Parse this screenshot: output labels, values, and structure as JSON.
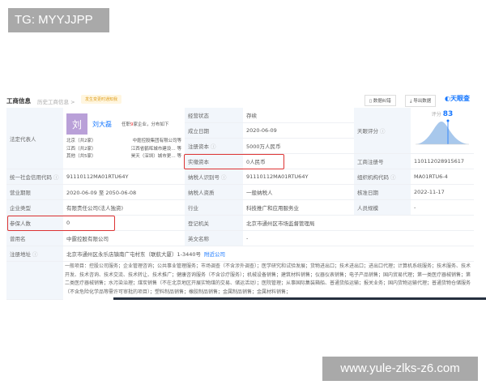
{
  "watermarks": {
    "top": "TG: MYYJJPP",
    "bottom": "www.yule-zlks-z6.com"
  },
  "header": {
    "title": "工商信息",
    "history": "历史工商信息 >",
    "tip": "发生变更时通知我",
    "btn_report": "数据纠错",
    "btn_export": "导出数据",
    "logo": "天眼查"
  },
  "legal": {
    "label": "法定代表人",
    "avatar": "刘",
    "name": "刘大磊",
    "summary_pre": "任职",
    "summary_count": "9",
    "summary_post": "家企业，分布如下",
    "regions": [
      {
        "r": "北京（共2家）",
        "c": "中霆控股集团有限公司等"
      },
      {
        "r": "江西（共2家）",
        "c": "江西省鹤晖城市建设…  等"
      },
      {
        "r": "其他（共5家）",
        "c": "昊天（深圳）城市更…  等"
      }
    ]
  },
  "rows_left": [
    {
      "label": "统一社会信用代码",
      "value": "91110112MA01RTU64Y"
    },
    {
      "label": "营业期限",
      "value": "2020-06-09 至 2050-06-08"
    },
    {
      "label": "企业类型",
      "value": "有限责任公司(法人独资)"
    },
    {
      "label": "参保人数",
      "value": "0"
    },
    {
      "label": "曾用名",
      "value": "中霆控股有限公司"
    },
    {
      "label": "注册地址",
      "value": "北京市通州区永乐店镇南广屯村东（联航大厦）1-3440号",
      "link": "附近公司"
    }
  ],
  "rows_mid": [
    {
      "label": "经营状态",
      "value": "存续"
    },
    {
      "label": "成立日期",
      "value": "2020-06-09"
    },
    {
      "label": "注册资本",
      "value": "5000万人民币"
    },
    {
      "label": "实缴资本",
      "value": "0人民币"
    },
    {
      "label": "纳税人识别号",
      "value": "91110112MA01RTU64Y"
    },
    {
      "label": "纳税人资质",
      "value": "一般纳税人"
    },
    {
      "label": "行业",
      "value": "科技推广和应用服务业"
    },
    {
      "label": "登记机关",
      "value": "北京市通州区市场监督管理局"
    },
    {
      "label": "英文名称",
      "value": "-"
    }
  ],
  "rows_right": [
    {
      "label": "天眼评分",
      "score_label": "评分",
      "score": "83"
    },
    {
      "label": "工商注册号",
      "value": "110112028915617"
    },
    {
      "label": "组织机构代码",
      "value": "MA01RTU6-4"
    },
    {
      "label": "核准日期",
      "value": "2022-11-17"
    },
    {
      "label": "人员规模",
      "value": "-"
    }
  ],
  "scope": "一般项目：控股公司服务；企业管理咨询；公共事业管理服务；市场调查（不含涉外调查）；医学研究和试验发展；货物进出口；技术进出口；进出口代理；计算机系统服务；技术服务、技术开发、技术咨询、技术交流、技术转让、技术推广；健康咨询服务（不含诊疗服务）；机械设备销售；建筑材料销售；仪器仪表销售；电子产品销售；国内贸易代理；第一类医疗器械销售；第二类医疗器械销售；水污染治理；煤炭销售（不在北京地区开展实物煤的交易、储运活动）；医院管理；从事国际集装箱船、普通货船运输；报关业务；国内货物运输代理；普通货物仓储服务（不含危险化学品等需许可审批的项目）；塑料制品销售；橡胶制品销售；金属制品销售；金属材料销售；",
  "colors": {
    "accent": "#1677ff",
    "highlight": "#d33333",
    "label_bg": "#f2f6fb"
  }
}
